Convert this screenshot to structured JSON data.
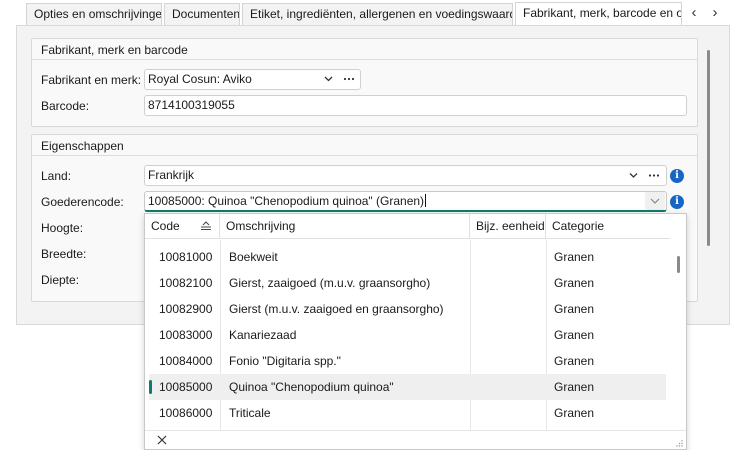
{
  "tabs": [
    {
      "label": "Opties en omschrijvingen",
      "active": false
    },
    {
      "label": "Documenten",
      "active": false
    },
    {
      "label": "Etiket, ingrediënten, allergenen en voedingswaarden",
      "active": false
    },
    {
      "label": "Fabrikant, merk, barcode en overige",
      "active": true
    }
  ],
  "tab_nav": {
    "prev": "‹",
    "next": "›"
  },
  "manufacturer_group": {
    "title": "Fabrikant, merk en barcode",
    "manufacturer_label": "Fabrikant en merk:",
    "manufacturer_value": "Royal Cosun: Aviko",
    "barcode_label": "Barcode:",
    "barcode_value": "8714100319055"
  },
  "properties_group": {
    "title": "Eigenschappen",
    "country_label": "Land:",
    "country_value": "Frankrijk",
    "goods_code_label": "Goederencode:",
    "goods_code_value": "10085000: Quinoa \"Chenopodium quinoa\" (Granen)",
    "height_label": "Hoogte:",
    "width_label": "Breedte:",
    "depth_label": "Diepte:"
  },
  "icons": {
    "chevron": "chevron-down-icon",
    "more": "ellipsis-icon",
    "info": "info-icon",
    "sort": "sort-ascending-icon",
    "close": "close-icon",
    "grip": "resize-grip-icon"
  },
  "accent_color": "#0f7b6c",
  "info_color": "#1766c4",
  "grid": {
    "columns": [
      "Code",
      "Omschrijving",
      "Bijz. eenheid",
      "Categorie"
    ],
    "rows": [
      {
        "code": "10081000",
        "description": "Boekweit",
        "unit": "",
        "category": "Granen",
        "selected": false
      },
      {
        "code": "10082100",
        "description": "Gierst, zaaigoed (m.u.v. graansorgho)",
        "unit": "",
        "category": "Granen",
        "selected": false
      },
      {
        "code": "10082900",
        "description": "Gierst (m.u.v. zaaigoed en graansorgho)",
        "unit": "",
        "category": "Granen",
        "selected": false
      },
      {
        "code": "10083000",
        "description": "Kanariezaad",
        "unit": "",
        "category": "Granen",
        "selected": false
      },
      {
        "code": "10084000",
        "description": "Fonio \"Digitaria spp.\"",
        "unit": "",
        "category": "Granen",
        "selected": false
      },
      {
        "code": "10085000",
        "description": "Quinoa \"Chenopodium quinoa\"",
        "unit": "",
        "category": "Granen",
        "selected": true
      },
      {
        "code": "10086000",
        "description": "Triticale",
        "unit": "",
        "category": "Granen",
        "selected": false
      }
    ]
  }
}
